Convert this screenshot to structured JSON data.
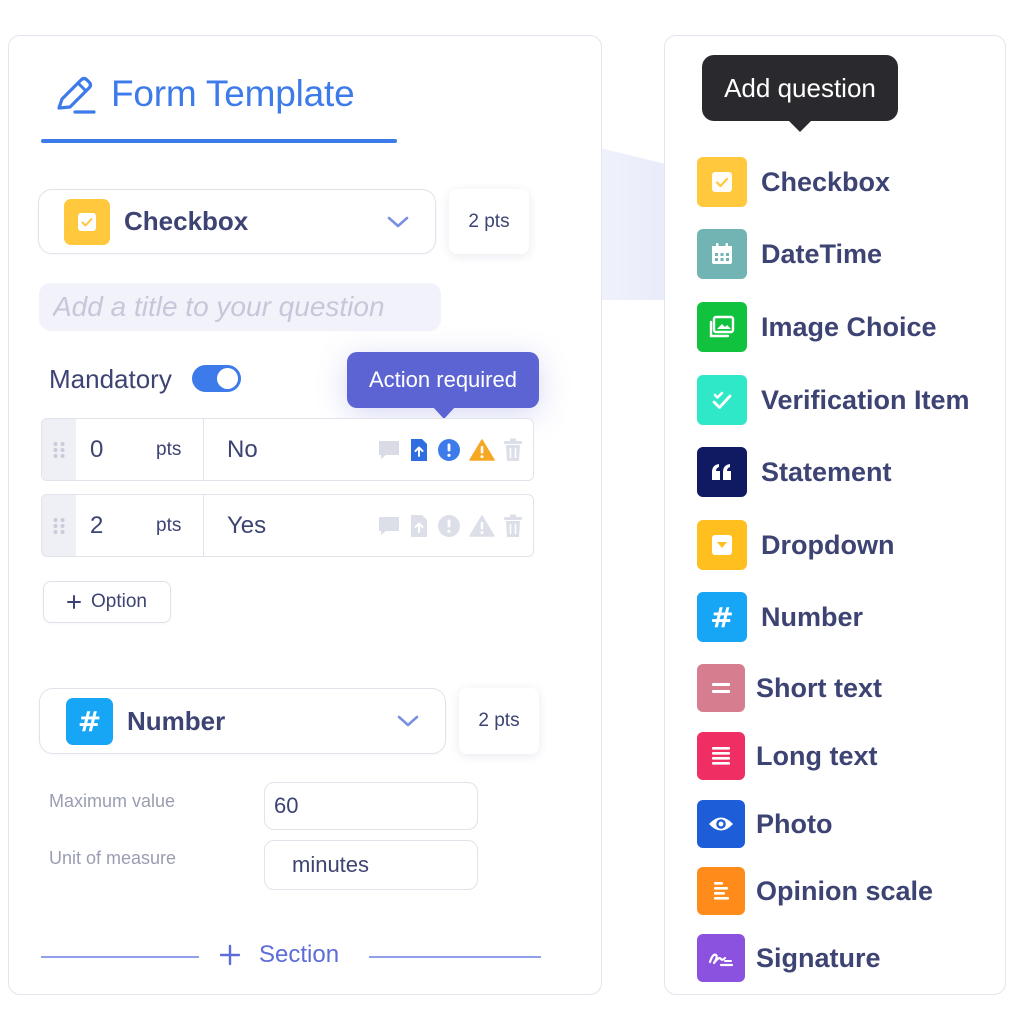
{
  "form": {
    "title": "Form Template",
    "question1": {
      "type_label": "Checkbox",
      "points": "2 pts",
      "title_placeholder": "Add a title to your question",
      "mandatory_label": "Mandatory",
      "tooltip": "Action required",
      "options": [
        {
          "points": "0",
          "unit": "pts",
          "answer": "No"
        },
        {
          "points": "2",
          "unit": "pts",
          "answer": "Yes"
        }
      ],
      "add_option_label": "Option"
    },
    "question2": {
      "type_label": "Number",
      "points": "2 pts",
      "max_label": "Maximum value",
      "max_value": "60",
      "unit_label": "Unit of measure",
      "unit_value": "minutes"
    },
    "add_section_label": "Section"
  },
  "panel": {
    "tooltip": "Add question",
    "types": [
      {
        "label": "Checkbox",
        "color": "#ffc83d",
        "icon": "checkbox-icon"
      },
      {
        "label": "DateTime",
        "color": "#72b4b4",
        "icon": "calendar-icon"
      },
      {
        "label": "Image Choice",
        "color": "#10c23d",
        "icon": "image-icon"
      },
      {
        "label": "Verification Item",
        "color": "#2ee8c8",
        "icon": "double-check-icon"
      },
      {
        "label": "Statement",
        "color": "#0f1a63",
        "icon": "quote-icon"
      },
      {
        "label": "Dropdown",
        "color": "#ffbf1f",
        "icon": "dropdown-icon"
      },
      {
        "label": "Number",
        "color": "#17a5f6",
        "icon": "hash-icon"
      },
      {
        "label": "Short text",
        "color": "#d77d90",
        "icon": "short-text-icon"
      },
      {
        "label": "Long text",
        "color": "#ef2f63",
        "icon": "long-text-icon"
      },
      {
        "label": "Photo",
        "color": "#1d5ed8",
        "icon": "eye-icon"
      },
      {
        "label": "Opinion scale",
        "color": "#ff8c1a",
        "icon": "scale-icon"
      },
      {
        "label": "Signature",
        "color": "#8a52de",
        "icon": "signature-icon"
      }
    ]
  },
  "colors": {
    "accent": "#3e7bea",
    "tooltip_purple": "#5c64d3",
    "warning": "#f7a823",
    "text_dark": "#3d4473"
  }
}
